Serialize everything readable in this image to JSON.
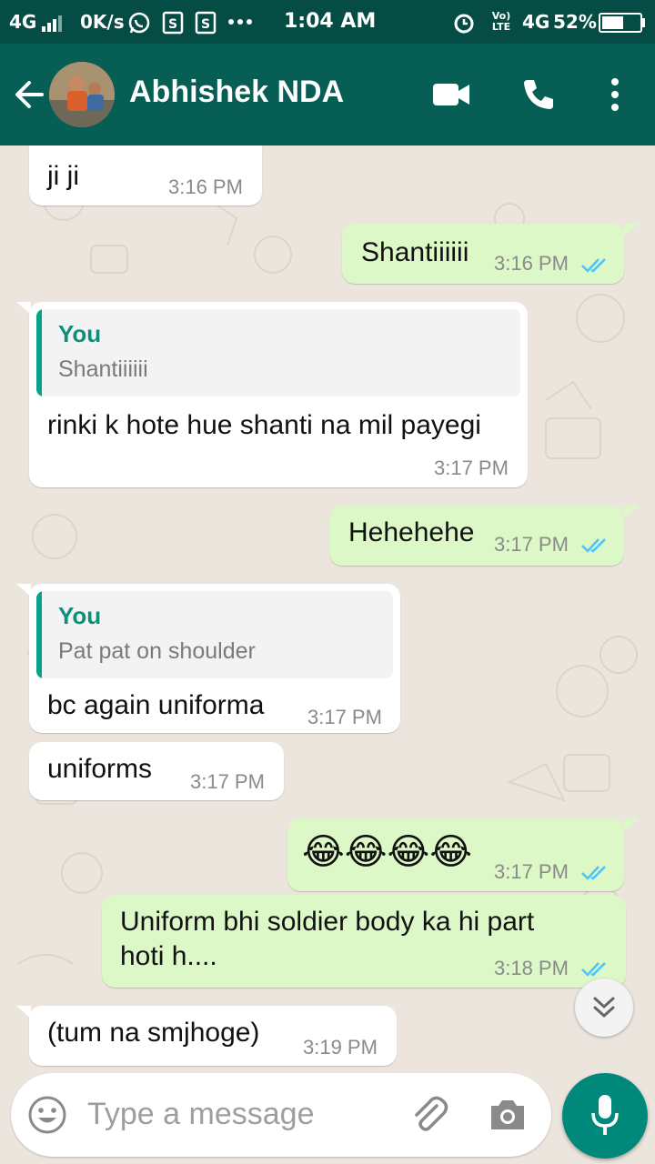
{
  "status_bar": {
    "network_left": "4G",
    "speed": "0K/s",
    "time": "1:04 AM",
    "volte": "Vo) LTE",
    "network_right": "4G",
    "battery": "52%",
    "icons": [
      "signal-icon",
      "whatsapp-icon",
      "sim-icon",
      "sim-icon",
      "more-dots-icon",
      "alarm-icon",
      "battery-icon"
    ]
  },
  "header": {
    "contact_name": "Abhishek NDA",
    "icons": [
      "back-arrow-icon",
      "video-call-icon",
      "phone-icon",
      "more-vert-icon"
    ]
  },
  "messages": [
    {
      "dir": "in",
      "text": "ji ji",
      "time": "3:16 PM"
    },
    {
      "dir": "out",
      "text": "Shantiiiiii",
      "time": "3:16 PM",
      "status": "read"
    },
    {
      "dir": "in",
      "quote": {
        "author": "You",
        "text": "Shantiiiiii"
      },
      "text": "rinki k hote hue shanti na mil payegi",
      "time": "3:17 PM"
    },
    {
      "dir": "out",
      "text": "Hehehehe",
      "time": "3:17 PM",
      "status": "read"
    },
    {
      "dir": "in",
      "quote": {
        "author": "You",
        "text": "Pat pat on shoulder"
      },
      "text": "bc again uniforma",
      "time": "3:17 PM"
    },
    {
      "dir": "in",
      "text": "uniforms",
      "time": "3:17 PM"
    },
    {
      "dir": "out",
      "text": "😂😂😂😂",
      "time": "3:17 PM",
      "status": "read"
    },
    {
      "dir": "out",
      "text_lines": [
        "Uniform bhi soldier  body ka hi part",
        "hoti h...."
      ],
      "time": "3:18 PM",
      "status": "read"
    },
    {
      "dir": "in",
      "text": "(tum na smjhoge)",
      "time": "3:19 PM"
    }
  ],
  "composer": {
    "placeholder": "Type a message",
    "icons": [
      "emoji-icon",
      "attach-icon",
      "camera-icon",
      "mic-icon",
      "scroll-down-icon"
    ]
  },
  "colors": {
    "header": "#075e54",
    "status_bar": "#054d44",
    "outgoing_bubble": "#dcf8c6",
    "incoming_bubble": "#ffffff",
    "accent": "#00897b",
    "read_ticks": "#4fc3f7"
  }
}
